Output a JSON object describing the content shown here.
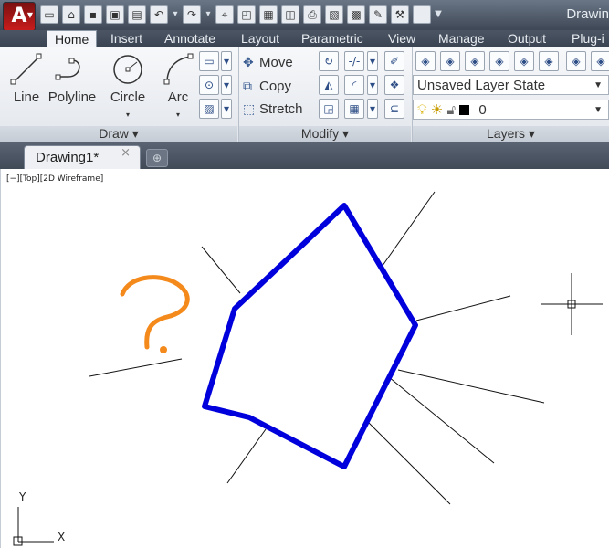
{
  "app": {
    "logo_letter": "A",
    "title": "Drawin"
  },
  "quick_access_icons": [
    "new-icon",
    "open-icon",
    "save-icon",
    "save-as-icon",
    "print-icon",
    "undo-icon",
    "redo-icon",
    "match-properties-icon",
    "layer-icon",
    "print-preview-icon",
    "publish-icon",
    "plot-icon",
    "color-icon",
    "measure-icon",
    "markup-icon",
    "brush-icon",
    "white-box-icon",
    "dropdown-icon"
  ],
  "ribbon_tabs": [
    "Home",
    "Insert",
    "Annotate",
    "Layout",
    "Parametric",
    "View",
    "Manage",
    "Output",
    "Plug-i"
  ],
  "draw_panel": {
    "title": "Draw",
    "tools": [
      "Line",
      "Polyline",
      "Circle",
      "Arc"
    ]
  },
  "modify_panel": {
    "title": "Modify",
    "rows": [
      "Move",
      "Copy",
      "Stretch"
    ]
  },
  "layers_panel": {
    "title": "Layers",
    "layer_state": "Unsaved Layer State",
    "current_layer": "0"
  },
  "document_tabs": [
    {
      "label": "Drawing1*",
      "close": "×"
    }
  ],
  "viewport": {
    "label": "[−][Top][2D Wireframe]"
  },
  "ucs": {
    "x_label": "X",
    "y_label": "Y"
  },
  "colors": {
    "polygon": "#0000dd",
    "annotation": "#f48a1c",
    "background": "#ffffff"
  }
}
